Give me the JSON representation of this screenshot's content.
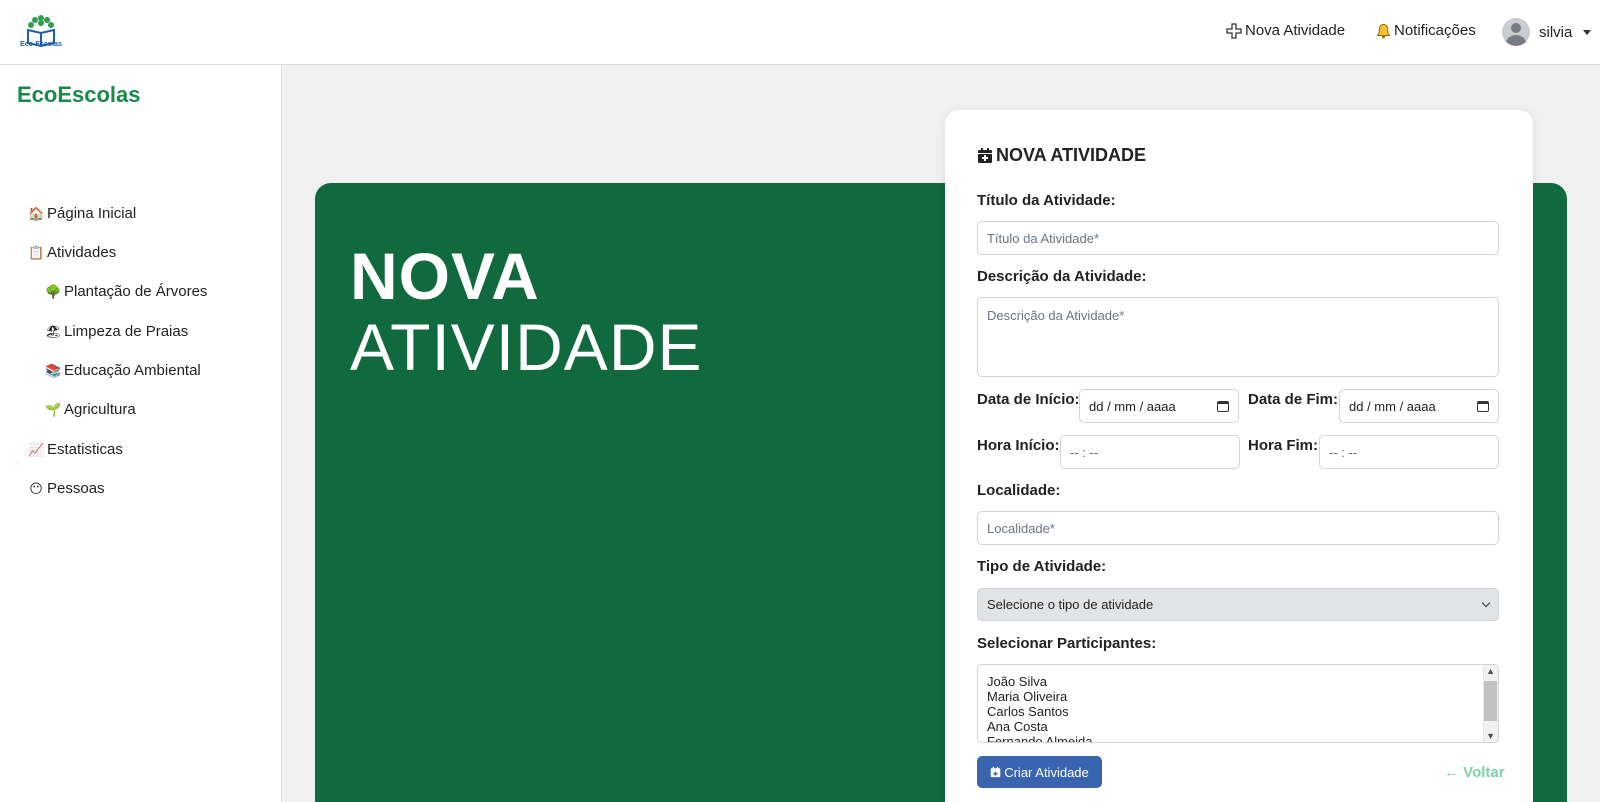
{
  "topbar": {
    "logo_text": "Eco-Escolas",
    "new_activity": "Nova Atividade",
    "notifications": "Notificações",
    "user": "silvia"
  },
  "sidebar": {
    "brand": "EcoEscolas",
    "items": [
      {
        "label": "Página Inicial",
        "icon": "house-icon"
      },
      {
        "label": "Atividades",
        "icon": "clipboard-icon"
      },
      {
        "label": "Plantação de Árvores",
        "icon": "tree-icon"
      },
      {
        "label": "Limpeza de Praias",
        "icon": "beach-icon"
      },
      {
        "label": "Educação Ambiental",
        "icon": "books-icon"
      },
      {
        "label": "Agricultura",
        "icon": "plant-icon"
      },
      {
        "label": "Estatisticas",
        "icon": "chart-icon"
      },
      {
        "label": "Pessoas",
        "icon": "face-icon"
      }
    ]
  },
  "hero": {
    "line1": "NOVA",
    "line2": "ATIVIDADE"
  },
  "form": {
    "title": "NOVA ATIVIDADE",
    "title_label": "Título da Atividade:",
    "title_placeholder": "Título da Atividade*",
    "desc_label": "Descrição da Atividade:",
    "desc_placeholder": "Descrição da Atividade*",
    "start_date_label": "Data de Início:",
    "start_date_value": "dd / mm / aaaa",
    "end_date_label": "Data de Fim:",
    "end_date_value": "dd / mm / aaaa",
    "start_time_label": "Hora Início:",
    "start_time_value": "-- : --",
    "end_time_label": "Hora Fim:",
    "end_time_value": "-- : --",
    "location_label": "Localidade:",
    "location_placeholder": "Localidade*",
    "type_label": "Tipo de Atividade:",
    "type_selected": "Selecione o tipo de atividade",
    "participants_label": "Selecionar Participantes:",
    "participants": [
      "João Silva",
      "Maria Oliveira",
      "Carlos Santos",
      "Ana Costa",
      "Fernando Almeida"
    ],
    "submit": "Criar Atividade",
    "back": "Voltar"
  },
  "colors": {
    "brand_green": "#1a8a4a",
    "hero_green": "#116a3d",
    "button_blue": "#3a64b0",
    "back_link": "#7ed4a6"
  }
}
